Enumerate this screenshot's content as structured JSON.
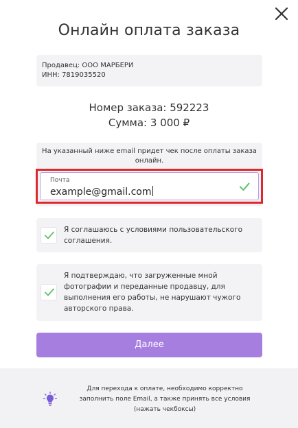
{
  "title": "Онлайн оплата заказа",
  "seller": {
    "name_line": "Продавец: ООО МАРБЕРИ",
    "inn_line": "ИНН: 7819035520"
  },
  "order": {
    "number_line": "Номер заказа: 592223",
    "sum_line": "Сумма: 3 000 ₽"
  },
  "email": {
    "hint": "На указанный ниже email придет чек после оплаты заказа онлайн.",
    "label": "Почта",
    "value": "example@gmail.com",
    "valid_icon": "check-icon"
  },
  "agreements": [
    {
      "text": "Я соглашаюсь с условиями пользовательского соглашения.",
      "checked": true
    },
    {
      "text": "Я подтверждаю, что загруженные мной фотографии и переданные продавцу, для выполнения его работы, не нарушают чужого авторского права.",
      "checked": true
    }
  ],
  "next_button": "Далее",
  "footer": {
    "icon": "lightbulb-icon",
    "text": "Для перехода к оплате, необходимо корректно заполнить поле Email, а также принять все условия (нажать чекбоксы)"
  },
  "colors": {
    "accent": "#a57ee0",
    "check": "#5cc06a",
    "highlight": "#e2262b",
    "panel": "#f3f3f5"
  }
}
